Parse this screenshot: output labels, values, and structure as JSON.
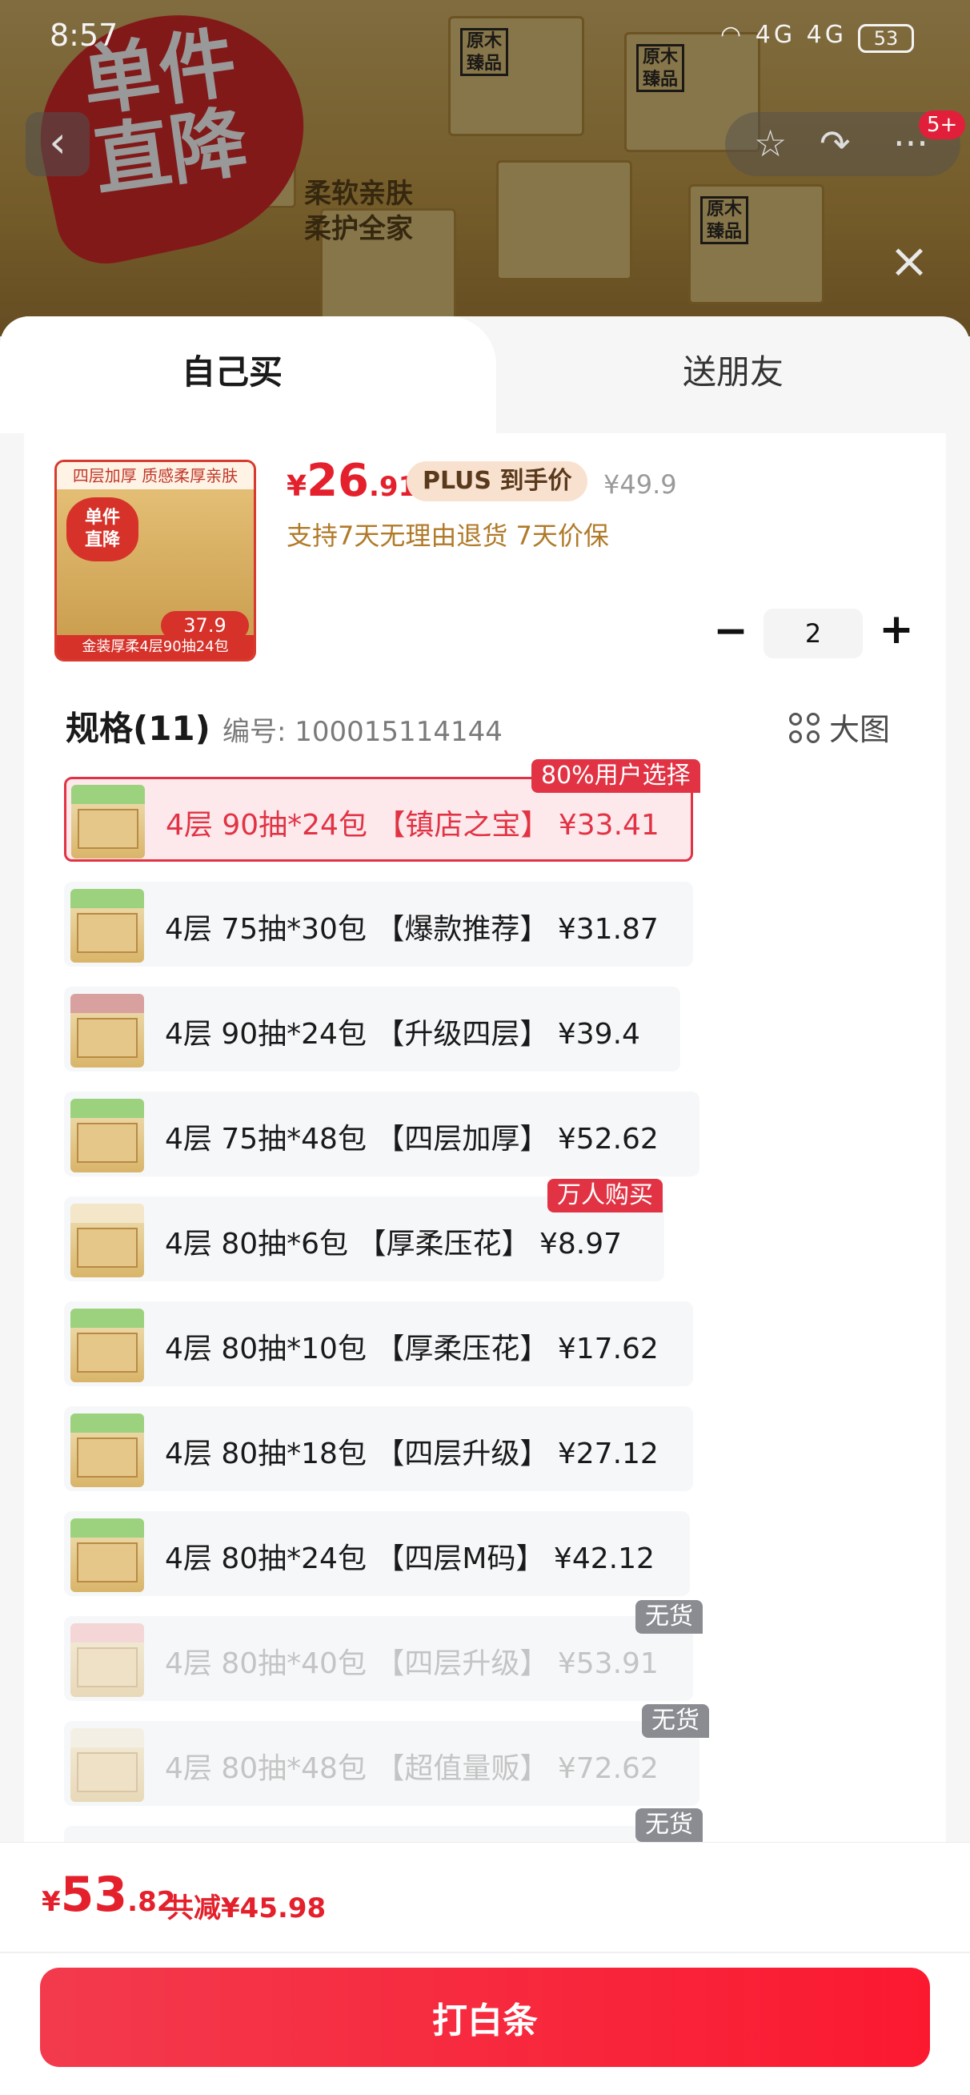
{
  "status_bar": {
    "time": "8:57",
    "battery": "53",
    "network": "4G 4G"
  },
  "background": {
    "promo_badge": "单件\n直降",
    "subtitle": "柔软亲肤\n柔护全家",
    "more_badge": "5+"
  },
  "tabs": {
    "own": "自己买",
    "friend": "送朋友"
  },
  "product": {
    "thumb_top": "四层加厚 质感柔厚亲肤",
    "thumb_badge": "单件\n直降",
    "thumb_price": "37.9",
    "thumb_bottom": "金装厚柔4层90抽24包",
    "price_currency": "¥",
    "price_int": "26",
    "price_dec": ".91",
    "plus_tag": "PLUS 到手价",
    "original_price": "¥49.9",
    "promise": "支持7天无理由退货  7天价保"
  },
  "quantity": {
    "minus": "−",
    "value": "2",
    "plus": "+"
  },
  "spec": {
    "title": "规格(11)",
    "code": "编号: 100015114144",
    "big_image": "大图"
  },
  "options": [
    {
      "label": "4层 90抽*24包 【镇店之宝】  ¥33.41",
      "tag": "80%用户选择"
    },
    {
      "label": "4层 75抽*30包 【爆款推荐】  ¥31.87",
      "tag": ""
    },
    {
      "label": "4层 90抽*24包 【升级四层】  ¥39.4",
      "tag": ""
    },
    {
      "label": "4层 75抽*48包 【四层加厚】  ¥52.62",
      "tag": ""
    },
    {
      "label": "4层 80抽*6包 【厚柔压花】  ¥8.97",
      "tag": "万人购买"
    },
    {
      "label": "4层 80抽*10包 【厚柔压花】  ¥17.62",
      "tag": ""
    },
    {
      "label": "4层 80抽*18包 【四层升级】  ¥27.12",
      "tag": ""
    },
    {
      "label": "4层 80抽*24包 【四层M码】  ¥42.12",
      "tag": ""
    },
    {
      "label": "4层 80抽*40包 【四层升级】  ¥53.91",
      "tag": "无货"
    },
    {
      "label": "4层 80抽*48包 【超值量贩】  ¥72.62",
      "tag": "无货"
    },
    {
      "label": "",
      "tag": "无货"
    }
  ],
  "footer": {
    "total_currency": "¥",
    "total_int": "53",
    "total_dec": ".82",
    "saved": "共减¥45.98",
    "buy_button": "打白条"
  },
  "colors": {
    "accent": "#e4202c",
    "selected_bg": "#fde8ec",
    "tag_gray": "#8a8c91"
  }
}
